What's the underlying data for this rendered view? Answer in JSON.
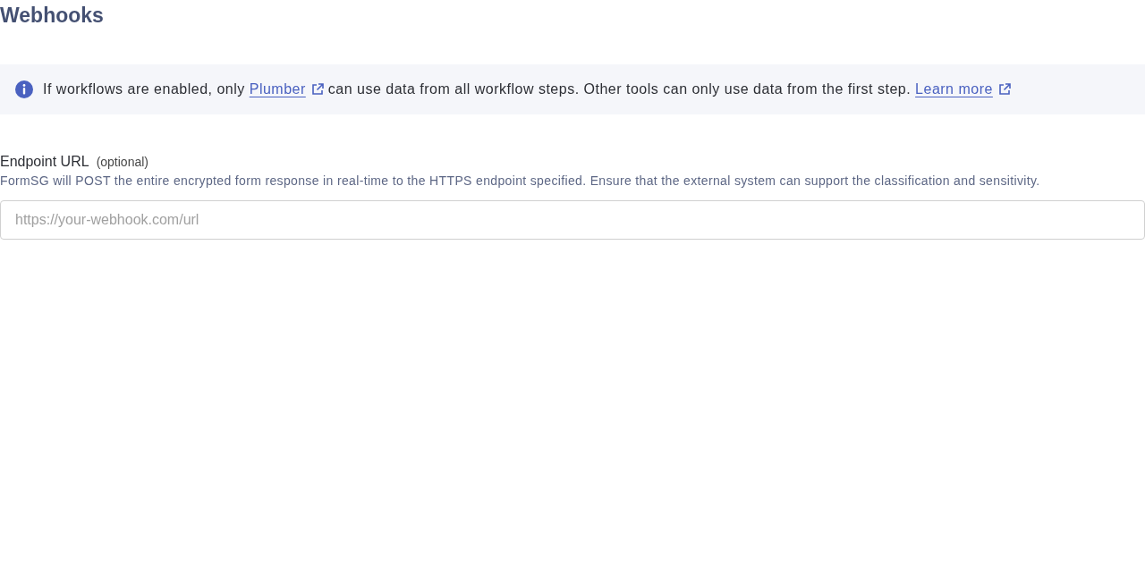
{
  "page": {
    "title": "Webhooks"
  },
  "info_banner": {
    "parts": [
      {
        "kind": "text",
        "text": "If workflows are enabled, only "
      },
      {
        "kind": "link",
        "text": "Plumber",
        "external": true
      },
      {
        "kind": "text",
        "text": " can use data from all workflow steps. Other tools can only use data from the first step. "
      },
      {
        "kind": "link",
        "text": "Learn more",
        "external": true
      }
    ]
  },
  "endpoint_field": {
    "label": "Endpoint URL",
    "optional_tag": "(optional)",
    "description": "FormSG will POST the entire encrypted form response in real-time to the HTTPS endpoint specified. Ensure that the external system can support the classification and sensitivity.",
    "placeholder": "https://your-webhook.com/url"
  }
}
